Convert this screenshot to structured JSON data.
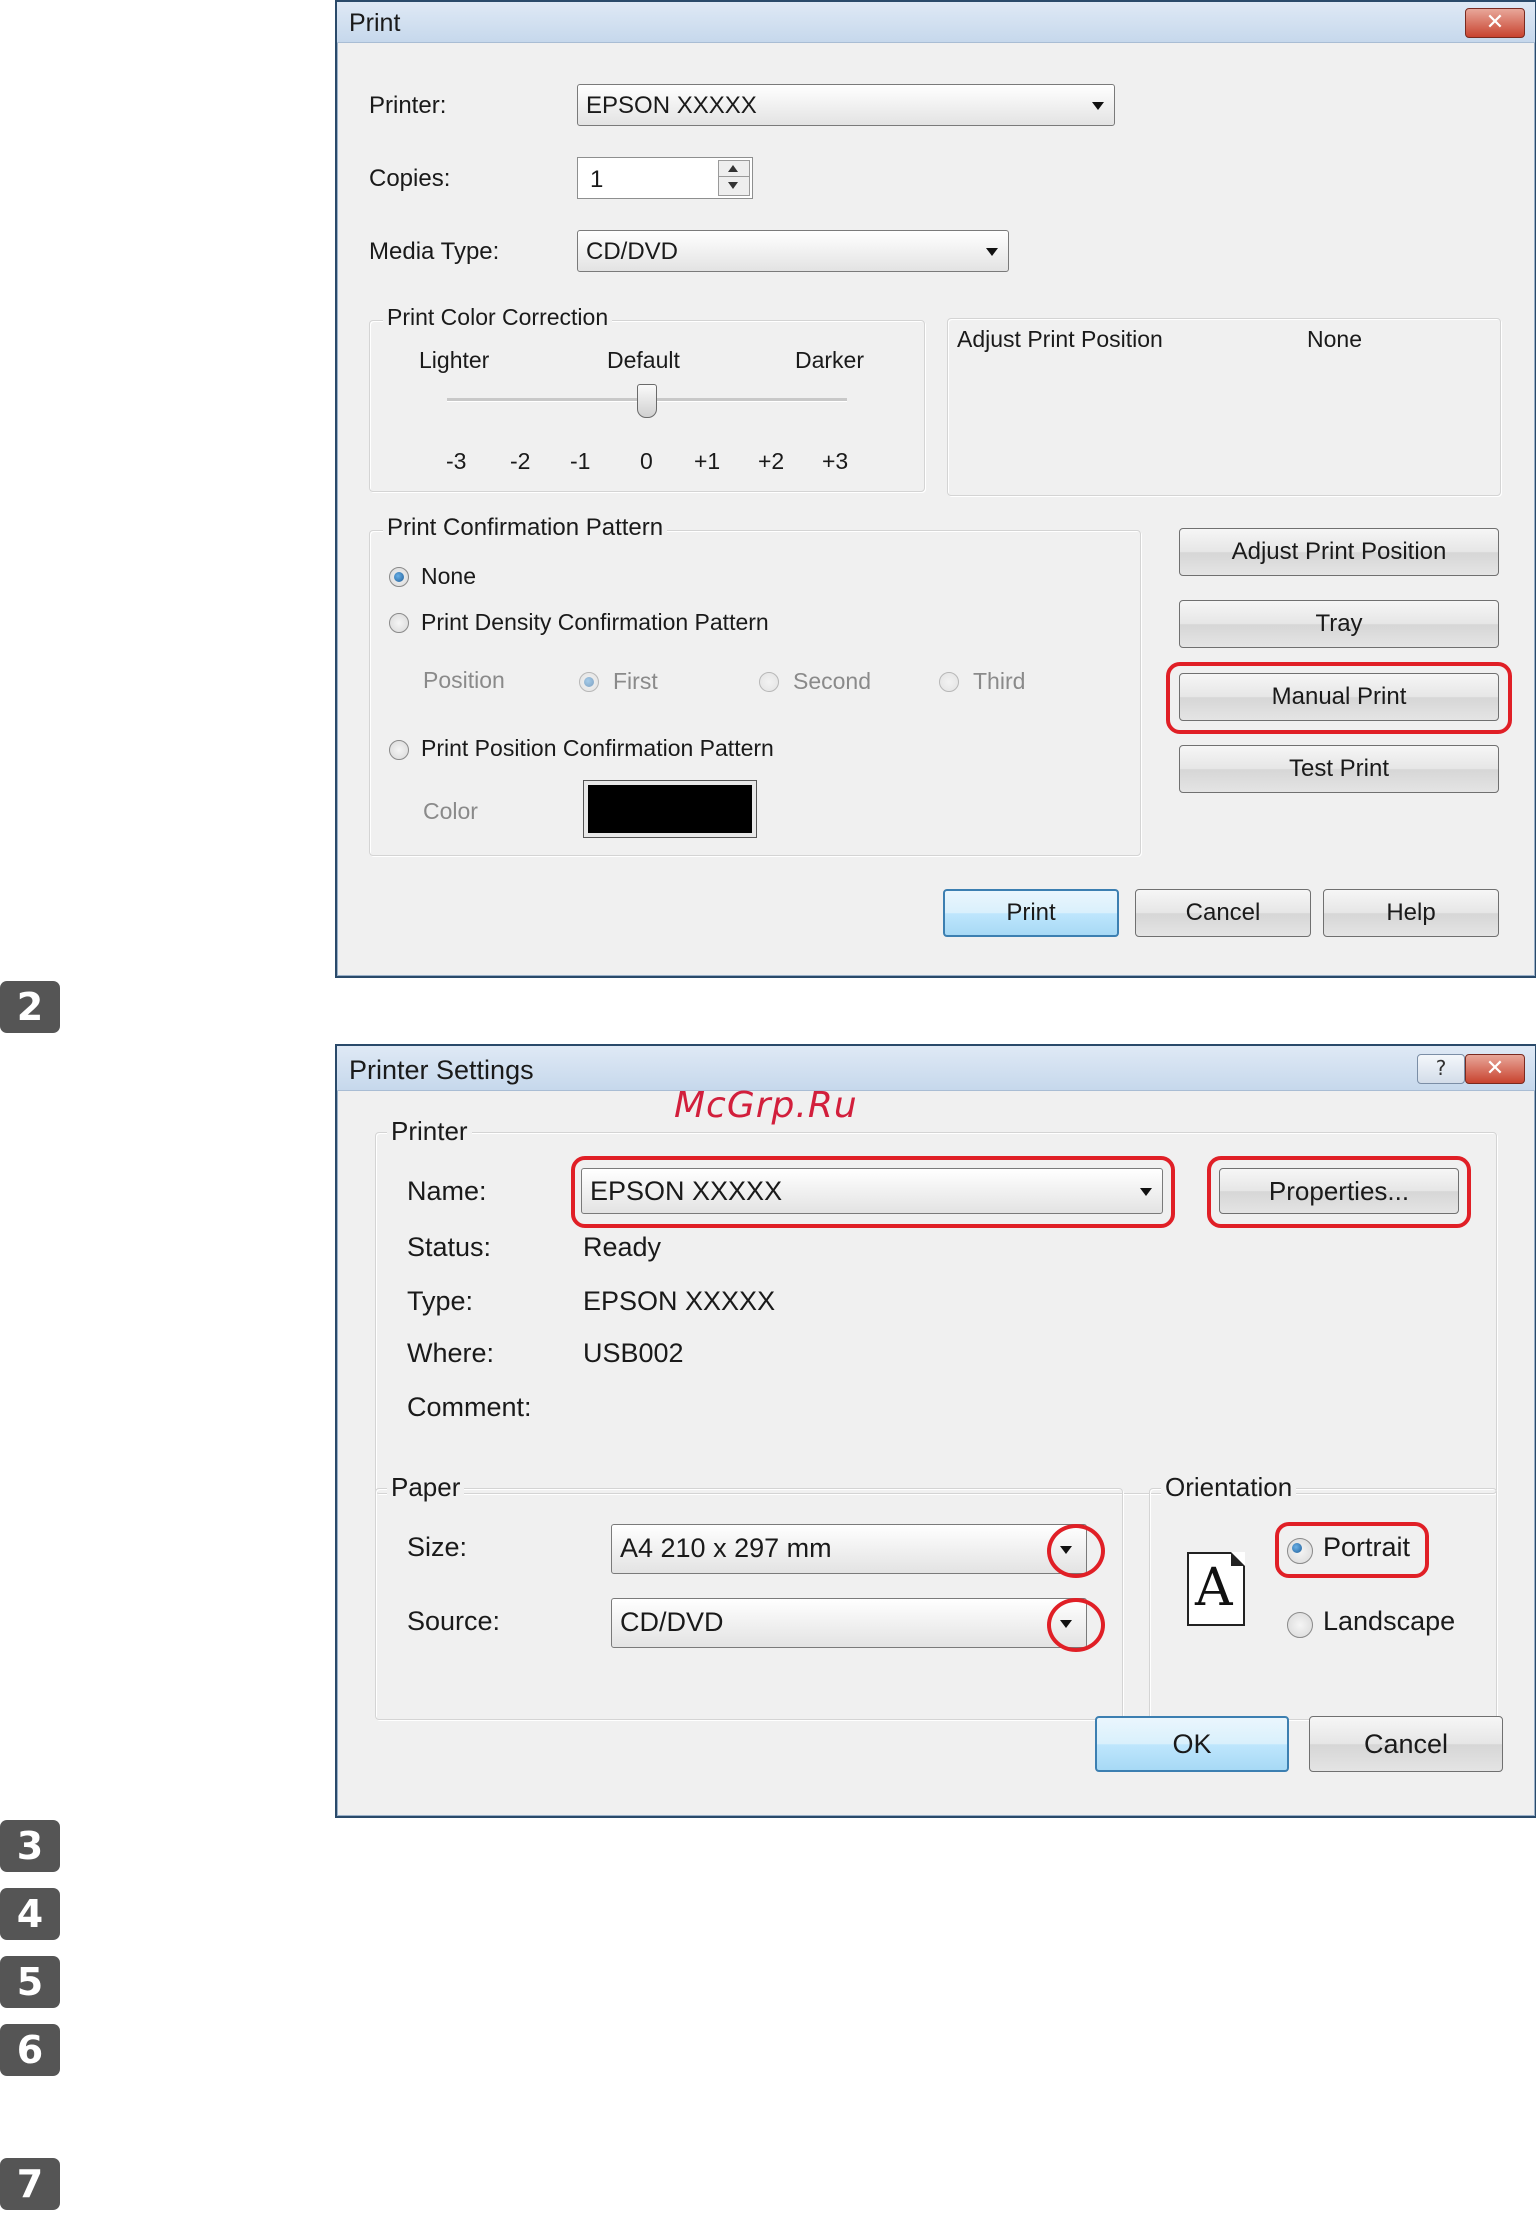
{
  "steps": [
    "2",
    "3",
    "4",
    "5",
    "6",
    "7"
  ],
  "watermark": "McGrp.Ru",
  "print_dialog": {
    "title": "Print",
    "close_glyph": "✕",
    "printer_label": "Printer:",
    "printer_value": "EPSON XXXXX",
    "copies_label": "Copies:",
    "copies_value": "1",
    "media_type_label": "Media Type:",
    "media_type_value": "CD/DVD",
    "color_correction": {
      "title": "Print Color Correction",
      "lighter": "Lighter",
      "default": "Default",
      "darker": "Darker",
      "ticks": [
        "-3",
        "-2",
        "-1",
        "0",
        "+1",
        "+2",
        "+3"
      ],
      "selected_value": "0"
    },
    "adjust_position": {
      "label": "Adjust Print Position",
      "value": "None"
    },
    "confirmation": {
      "title": "Print Confirmation Pattern",
      "none": "None",
      "density": "Print Density Confirmation Pattern",
      "position_label": "Position",
      "first": "First",
      "second": "Second",
      "third": "Third",
      "position_pattern": "Print Position Confirmation Pattern",
      "color_label": "Color",
      "color_swatch": "#000000",
      "selected": "None"
    },
    "buttons": {
      "adjust": "Adjust Print Position",
      "tray": "Tray",
      "manual": "Manual Print",
      "test": "Test Print",
      "print": "Print",
      "cancel": "Cancel",
      "help": "Help"
    }
  },
  "printer_settings": {
    "title": "Printer Settings",
    "help_glyph": "?",
    "close_glyph": "✕",
    "printer_group": "Printer",
    "name_label": "Name:",
    "name_value": "EPSON XXXXX",
    "properties": "Properties...",
    "status_label": "Status:",
    "status_value": "Ready",
    "type_label": "Type:",
    "type_value": "EPSON XXXXX",
    "where_label": "Where:",
    "where_value": "USB002",
    "comment_label": "Comment:",
    "comment_value": "",
    "paper_group": "Paper",
    "size_label": "Size:",
    "size_value": "A4 210 x 297 mm",
    "source_label": "Source:",
    "source_value": "CD/DVD",
    "orientation_group": "Orientation",
    "orientation_icon": "A",
    "portrait": "Portrait",
    "landscape": "Landscape",
    "selected_orientation": "Portrait",
    "ok": "OK",
    "cancel": "Cancel"
  },
  "highlight_color": "#e01f26"
}
